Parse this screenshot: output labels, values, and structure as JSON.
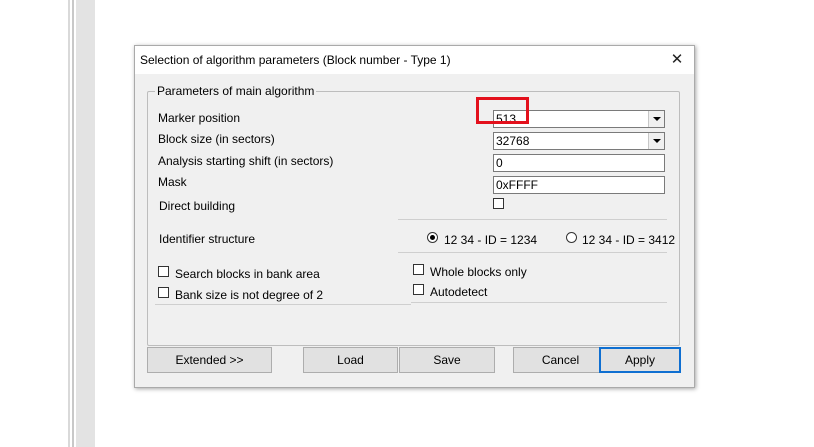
{
  "dialog": {
    "title": "Selection of algorithm parameters (Block number - Type 1)",
    "close_icon": "close-icon"
  },
  "group": {
    "title": "Parameters of main algorithm",
    "marker_position": {
      "label": "Marker position",
      "value": "513"
    },
    "block_size": {
      "label": "Block size (in sectors)",
      "value": "32768"
    },
    "analysis_shift": {
      "label": "Analysis starting shift (in sectors)",
      "value": "0"
    },
    "mask": {
      "label": "Mask",
      "value": "0xFFFF"
    },
    "direct_building": {
      "label": "Direct building",
      "checked": false
    },
    "identifier": {
      "label": "Identifier structure",
      "option1": "12 34 - ID = 1234",
      "option2": "12 34 - ID = 3412",
      "selected": "option1"
    },
    "search_blocks": {
      "label": "Search blocks in bank area",
      "checked": false
    },
    "bank_size": {
      "label": "Bank size is not degree of 2",
      "checked": false
    },
    "whole_blocks": {
      "label": "Whole blocks only",
      "checked": false
    },
    "autodetect": {
      "label": "Autodetect",
      "checked": false
    }
  },
  "buttons": {
    "extended": "Extended >>",
    "load": "Load",
    "save": "Save",
    "cancel": "Cancel",
    "apply": "Apply"
  },
  "colors": {
    "highlight": "#e3101c",
    "default_button_border": "#0f6fd1",
    "dialog_bg": "#f0f0f0"
  }
}
